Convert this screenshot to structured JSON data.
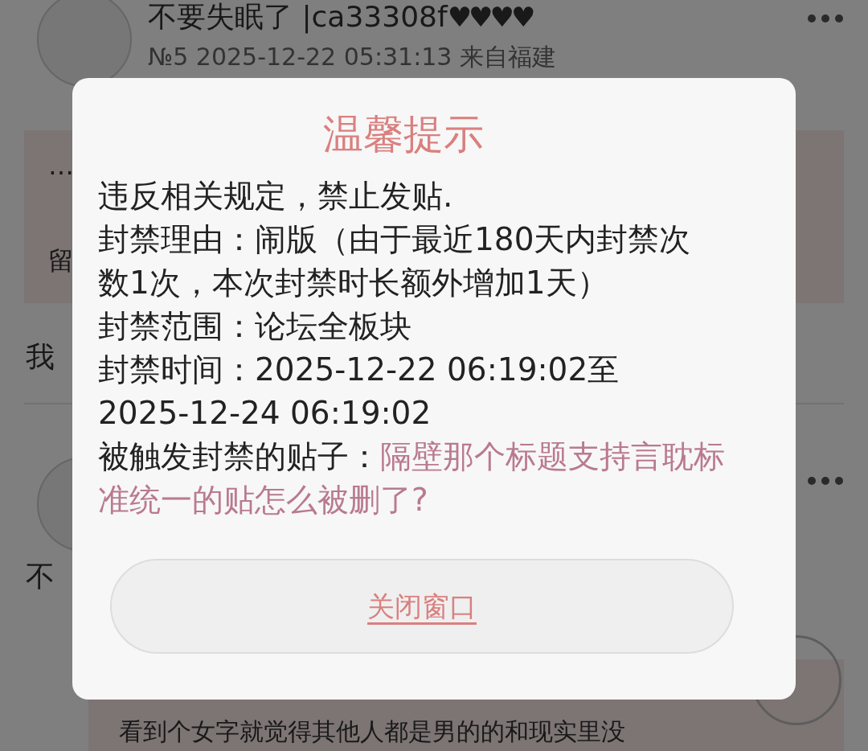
{
  "background": {
    "posts": [
      {
        "username": "不要失眠了 |ca33308f",
        "hearts": "♥♥♥♥",
        "meta": "№5 2025-12-22 05:31:13 来自福建",
        "quote_lines": [
          "…",
          "留"
        ],
        "reply": "我"
      },
      {
        "reply": "不",
        "quote_text": "看到个女字就觉得其他人都是男的的和现实里没"
      }
    ]
  },
  "dialog": {
    "title": "温馨提示",
    "lines": [
      {
        "kind": "text",
        "text": "违反相关规定，禁止发贴."
      },
      {
        "kind": "text",
        "text": "封禁理由：闹版（由于最近180天内封禁次数1次，本次封禁时长额外增加1天）"
      },
      {
        "kind": "text",
        "text": "封禁范围：论坛全板块"
      },
      {
        "kind": "text",
        "text": "封禁时间：2025-12-22 06:19:02至2025-12-24 06:19:02"
      },
      {
        "kind": "link",
        "label": "被触发封禁的贴子：",
        "link_lines": [
          "隔壁那个标题支持言耽标",
          "准统一的贴怎么被删了?"
        ]
      }
    ],
    "button": "关闭窗口"
  }
}
